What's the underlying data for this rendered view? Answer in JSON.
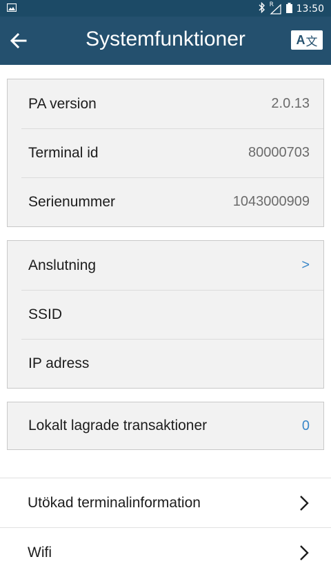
{
  "status_bar": {
    "time": "13:50",
    "icons": [
      "image-icon",
      "bluetooth-icon",
      "signal-roaming-icon",
      "battery-icon"
    ],
    "roaming_indicator": "R"
  },
  "app_bar": {
    "title": "Systemfunktioner",
    "back_icon": "arrow-left-icon",
    "language_button": {
      "latin": "A",
      "cjk": "文"
    }
  },
  "info_card": {
    "rows": [
      {
        "label": "PA version",
        "value": "2.0.13"
      },
      {
        "label": "Terminal id",
        "value": "80000703"
      },
      {
        "label": "Serienummer",
        "value": "1043000909"
      }
    ]
  },
  "connection_card": {
    "rows": [
      {
        "label": "Anslutning",
        "value": ">"
      },
      {
        "label": "SSID",
        "value": ""
      },
      {
        "label": "IP adress",
        "value": ""
      }
    ]
  },
  "transactions_card": {
    "label": "Lokalt lagrade transaktioner",
    "value": "0"
  },
  "menu": {
    "items": [
      {
        "label": "Utökad terminalinformation",
        "icon": "chevron-right-icon"
      },
      {
        "label": "Wifi",
        "icon": "chevron-right-icon"
      }
    ]
  },
  "colors": {
    "status_bar_bg": "#1c4a66",
    "app_bar_bg": "#24506e",
    "card_bg": "#f2f2f2",
    "accent": "#3a87c8"
  }
}
